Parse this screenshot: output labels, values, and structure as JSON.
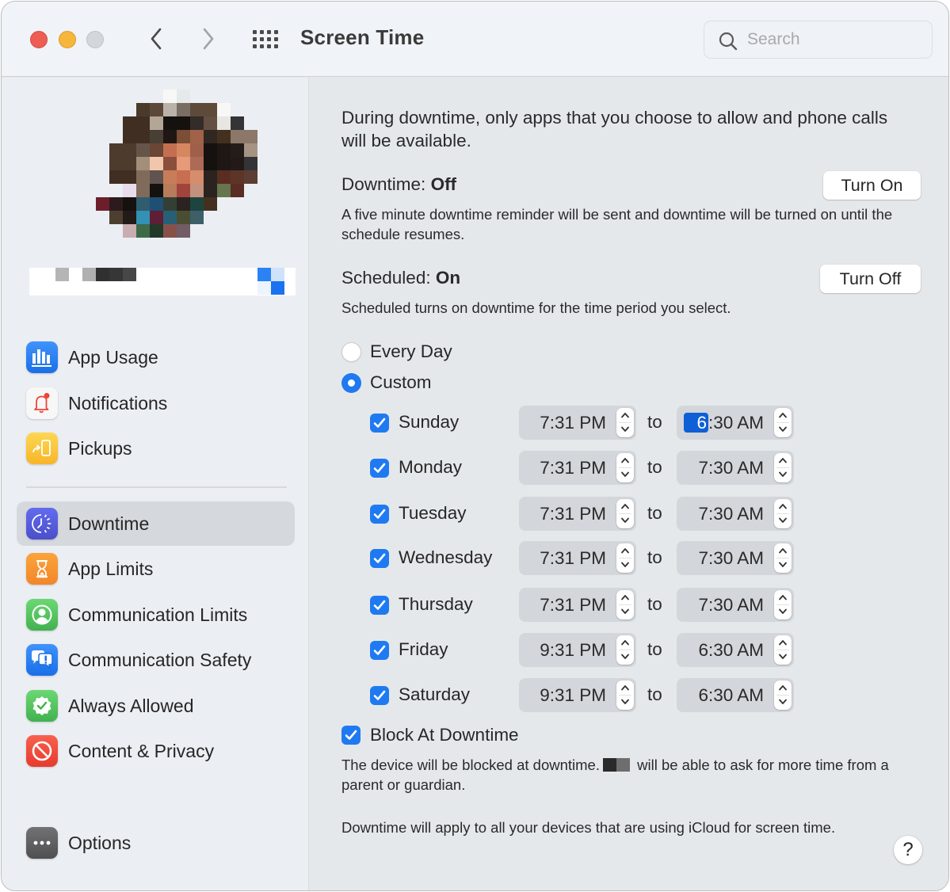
{
  "window": {
    "title": "Screen Time",
    "search": {
      "placeholder": "Search",
      "value": ""
    },
    "icons": {
      "close": "close-window-button",
      "minimize": "minimize-window-button",
      "zoom": "zoom-window-button",
      "back": "chevron-left-icon",
      "forward": "chevron-right-icon",
      "grid": "show-all-grid-icon",
      "search": "magnifying-glass-icon"
    }
  },
  "sidebar": {
    "user": {
      "avatar": "pixelated-avatar",
      "name": "redacted"
    },
    "items_top": [
      {
        "label": "App Usage",
        "icon": "bar-chart-icon",
        "color": "#1f7af2"
      },
      {
        "label": "Notifications",
        "icon": "bell-icon",
        "color": "#f5f5f5"
      },
      {
        "label": "Pickups",
        "icon": "pickup-phone-icon",
        "color": "#fbc43a"
      }
    ],
    "items_main": [
      {
        "label": "Downtime",
        "icon": "downtime-clock-icon",
        "color": "#5056d6",
        "selected": true
      },
      {
        "label": "App Limits",
        "icon": "hourglass-icon",
        "color": "#f6932b"
      },
      {
        "label": "Communication Limits",
        "icon": "person-circle-icon",
        "color": "#4cc15a"
      },
      {
        "label": "Communication Safety",
        "icon": "chat-bubbles-alert-icon",
        "color": "#1f7af2"
      },
      {
        "label": "Always Allowed",
        "icon": "checkmark-seal-icon",
        "color": "#4cc15a"
      },
      {
        "label": "Content & Privacy",
        "icon": "no-entry-icon",
        "color": "#ef4436"
      }
    ],
    "options": {
      "label": "Options",
      "icon": "ellipsis-icon",
      "color": "#5b5b5d"
    }
  },
  "content": {
    "intro": "During downtime, only apps that you choose to allow and phone calls will be available.",
    "downtime": {
      "label": "Downtime:",
      "state": "Off",
      "button": "Turn On",
      "desc": "A five minute downtime reminder will be sent and downtime will be turned on until the schedule resumes."
    },
    "scheduled": {
      "label": "Scheduled:",
      "state": "On",
      "button": "Turn Off",
      "desc": "Scheduled turns on downtime for the time period you select."
    },
    "schedule_mode": {
      "options": [
        {
          "label": "Every Day",
          "selected": false
        },
        {
          "label": "Custom",
          "selected": true
        }
      ]
    },
    "to_label": "to",
    "days": [
      {
        "day": "Sunday",
        "checked": true,
        "from": "7:31 PM",
        "to_hour": "6",
        "to_rest": ":30 AM",
        "to": "6:30 AM",
        "editing_hour": true
      },
      {
        "day": "Monday",
        "checked": true,
        "from": "7:31 PM",
        "to": "7:30 AM"
      },
      {
        "day": "Tuesday",
        "checked": true,
        "from": "7:31 PM",
        "to": "7:30 AM"
      },
      {
        "day": "Wednesday",
        "checked": true,
        "from": "7:31 PM",
        "to": "7:30 AM"
      },
      {
        "day": "Thursday",
        "checked": true,
        "from": "7:31 PM",
        "to": "7:30 AM"
      },
      {
        "day": "Friday",
        "checked": true,
        "from": "9:31 PM",
        "to": "6:30 AM"
      },
      {
        "day": "Saturday",
        "checked": true,
        "from": "9:31 PM",
        "to": "6:30 AM"
      }
    ],
    "block": {
      "label": "Block At Downtime",
      "checked": true,
      "desc_before": "The device will be blocked at downtime.",
      "desc_after": " will be able to ask for more time from a parent or guardian."
    },
    "footer": "Downtime will apply to all your devices that are using iCloud for screen time.",
    "help_label": "?"
  },
  "colors": {
    "accent": "#1f7af2",
    "selection": "#0f5fd6",
    "sidebar_bg": "#ebeef3",
    "content_bg": "#e5e8eb",
    "selected_row": "#d5d8dd"
  }
}
